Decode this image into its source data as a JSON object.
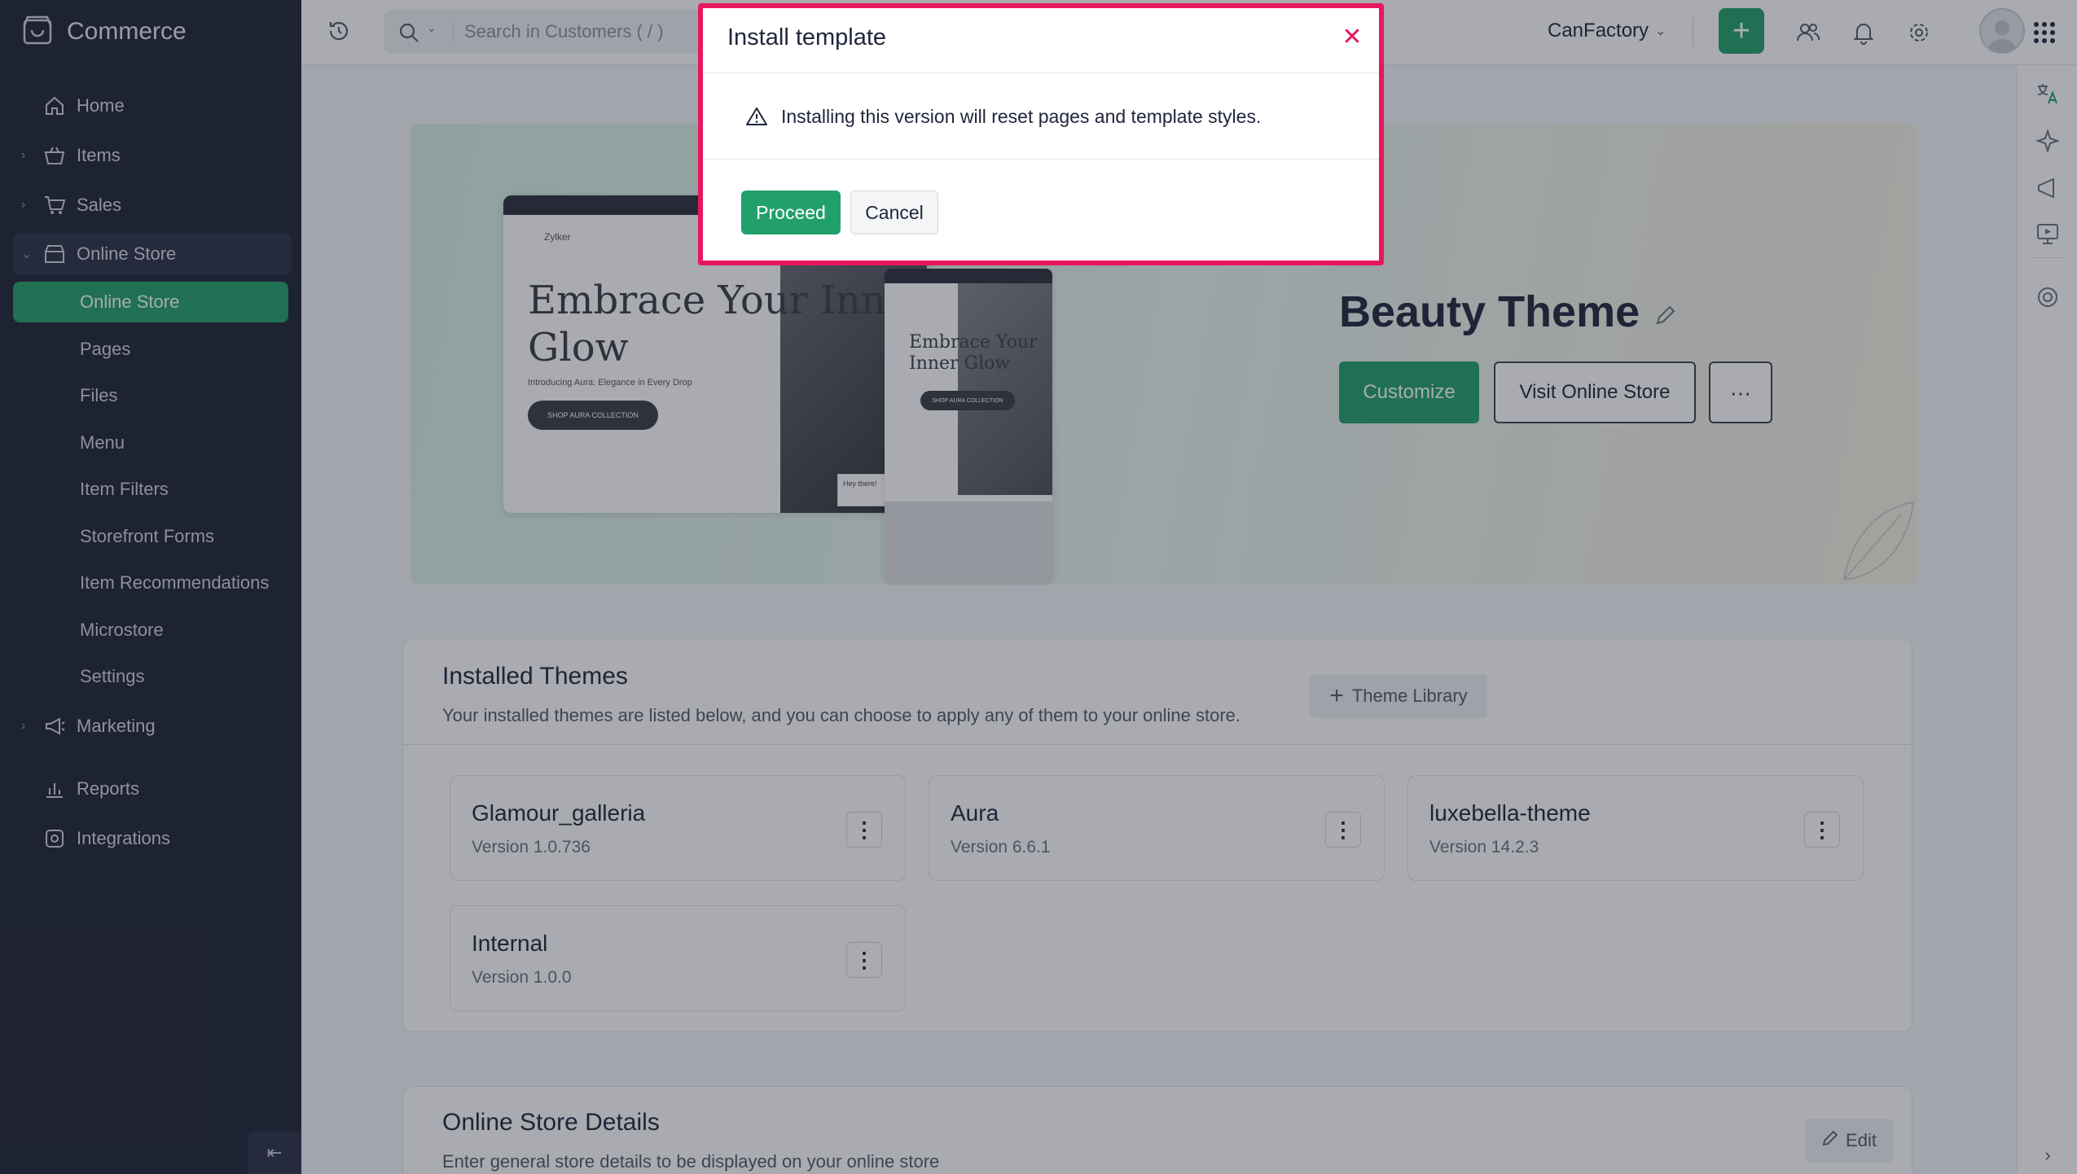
{
  "colors": {
    "accent": "#22a06b",
    "sidebar_bg": "#1f2436",
    "modal_highlight": "#e8175d"
  },
  "app": {
    "brand": "Commerce"
  },
  "sidebar": {
    "items": [
      {
        "label": "Home",
        "icon": "home-icon"
      },
      {
        "label": "Items",
        "icon": "basket-icon"
      },
      {
        "label": "Sales",
        "icon": "cart-icon"
      },
      {
        "label": "Online Store",
        "icon": "storefront-icon"
      },
      {
        "label": "Marketing",
        "icon": "megaphone-icon"
      },
      {
        "label": "Reports",
        "icon": "bar-chart-icon"
      },
      {
        "label": "Integrations",
        "icon": "integrations-icon"
      }
    ],
    "sub_items": [
      {
        "label": "Online Store"
      },
      {
        "label": "Pages"
      },
      {
        "label": "Files"
      },
      {
        "label": "Menu"
      },
      {
        "label": "Item Filters"
      },
      {
        "label": "Storefront Forms"
      },
      {
        "label": "Item Recommendations"
      },
      {
        "label": "Microstore"
      },
      {
        "label": "Settings"
      }
    ]
  },
  "topbar": {
    "search_placeholder": "Search in Customers ( / )",
    "org_name": "CanFactory"
  },
  "banner": {
    "mock_headline": "Embrace Your Inner Glow",
    "mock_subtitle": "Introducing Aura: Elegance in Every Drop",
    "mock_button": "SHOP AURA COLLECTION",
    "mock_brand": "Zylker",
    "mock_chat": "Hey there!",
    "theme_name": "Beauty Theme",
    "customize_label": "Customize",
    "visit_label": "Visit Online Store",
    "more_label": "···"
  },
  "installed_themes": {
    "title": "Installed Themes",
    "description": "Your installed themes are listed below, and you can choose to apply any of them to your online store.",
    "library_label": "Theme Library",
    "themes": [
      {
        "name": "Glamour_galleria",
        "version": "Version 1.0.736"
      },
      {
        "name": "Aura",
        "version": "Version 6.6.1"
      },
      {
        "name": "luxebella-theme",
        "version": "Version 14.2.3"
      },
      {
        "name": "Internal",
        "version": "Version 1.0.0"
      }
    ]
  },
  "store_details": {
    "title": "Online Store Details",
    "description": "Enter general store details to be displayed on your online store",
    "edit_label": "Edit"
  },
  "modal": {
    "title": "Install template",
    "message": "Installing this version will reset pages and template styles.",
    "proceed_label": "Proceed",
    "cancel_label": "Cancel"
  }
}
